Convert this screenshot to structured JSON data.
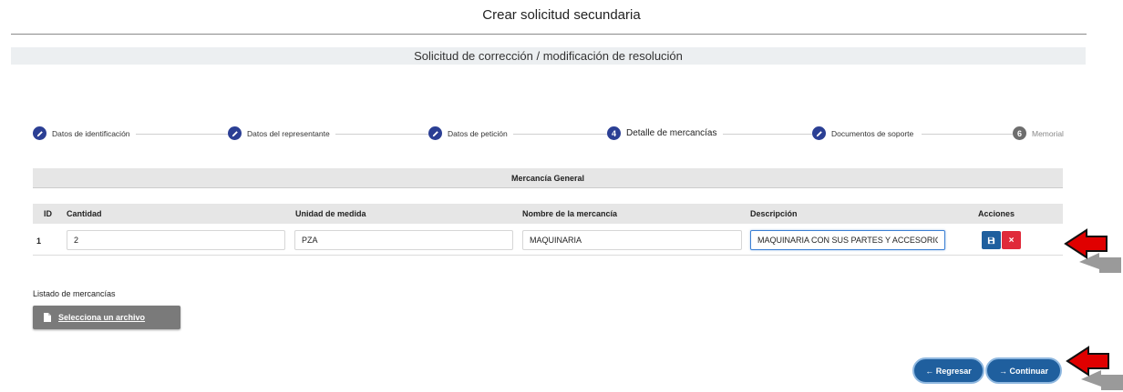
{
  "page": {
    "title": "Crear solicitud secundaria",
    "subtitle": "Solicitud de corrección / modificación de resolución"
  },
  "stepper": {
    "steps": [
      {
        "label": "Datos de identificación",
        "state": "done",
        "icon": "pencil-icon"
      },
      {
        "label": "Datos del representante",
        "state": "done",
        "icon": "pencil-icon"
      },
      {
        "label": "Datos de petición",
        "state": "done",
        "icon": "pencil-icon"
      },
      {
        "label": "Detalle de mercancías",
        "state": "active",
        "number": "4"
      },
      {
        "label": "Documentos de soporte",
        "state": "done",
        "icon": "pencil-icon"
      },
      {
        "label": "Memorial",
        "state": "pending",
        "number": "6"
      }
    ]
  },
  "merchandise": {
    "section_title": "Mercancía General",
    "columns": [
      "ID",
      "Cantidad",
      "Unidad de medida",
      "Nombre de la mercancía",
      "Descripción",
      "Acciones"
    ],
    "rows": [
      {
        "id": "1",
        "cantidad": "2",
        "unidad": "PZA",
        "nombre": "MAQUINARIA",
        "descripcion": "MAQUINARIA CON SUS PARTES Y ACCESORIOS"
      }
    ],
    "save_icon": "floppy-disk-icon",
    "delete_label": "×"
  },
  "file_upload": {
    "label": "Listado de mercancías",
    "button_label": "Selecciona un archivo",
    "icon": "document-icon"
  },
  "actions": {
    "back_label": "← Regresar",
    "continue_label": "→ Continuar"
  },
  "colors": {
    "primary": "#1f5f9e",
    "step_done": "#2b3f94",
    "step_pending": "#6d6d6d",
    "danger": "#e02a3a",
    "annotation_arrow": "#e00000"
  }
}
